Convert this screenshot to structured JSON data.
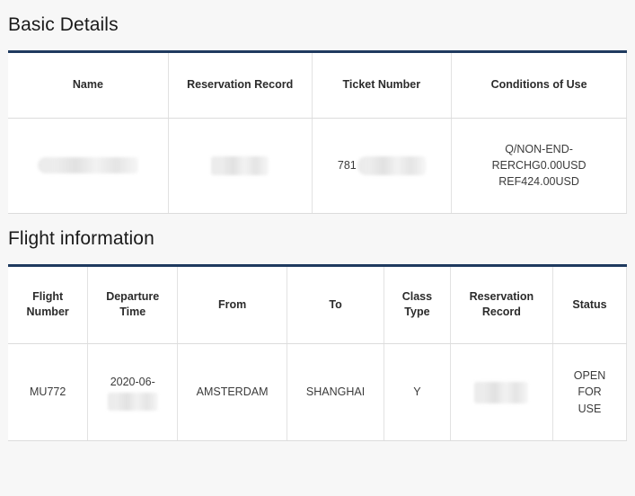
{
  "sections": {
    "basic_details": {
      "heading": "Basic Details",
      "columns": [
        "Name",
        "Reservation Record",
        "Ticket Number",
        "Conditions of Use"
      ],
      "row": {
        "name": "",
        "name_redacted": true,
        "reservation_record": "",
        "reservation_record_redacted": true,
        "ticket_number_prefix": "781",
        "ticket_number_redacted": true,
        "conditions_of_use": "Q/NON-END-\nRERCHG0.00USD\nREF424.00USD"
      }
    },
    "flight_information": {
      "heading": "Flight information",
      "columns": [
        "Flight\nNumber",
        "Departure\nTime",
        "From",
        "To",
        "Class\nType",
        "Reservation\nRecord",
        "Status"
      ],
      "row": {
        "flight_number": "MU772",
        "departure_time_prefix": "2020-06-",
        "departure_time_redacted": true,
        "from": "AMSTERDAM",
        "to": "SHANGHAI",
        "class_type": "Y",
        "reservation_record": "",
        "reservation_record_redacted": true,
        "status": "OPEN\nFOR\nUSE"
      }
    }
  },
  "colors": {
    "page_background": "#f7f7f7",
    "table_background": "#ffffff",
    "table_top_border": "#1f3a5f",
    "cell_border": "#e2e2e2",
    "heading_text": "#1a1a1a",
    "header_text": "#2b2b2b",
    "body_text": "#3b3b3b",
    "redaction_block": "#e4e4e4"
  }
}
